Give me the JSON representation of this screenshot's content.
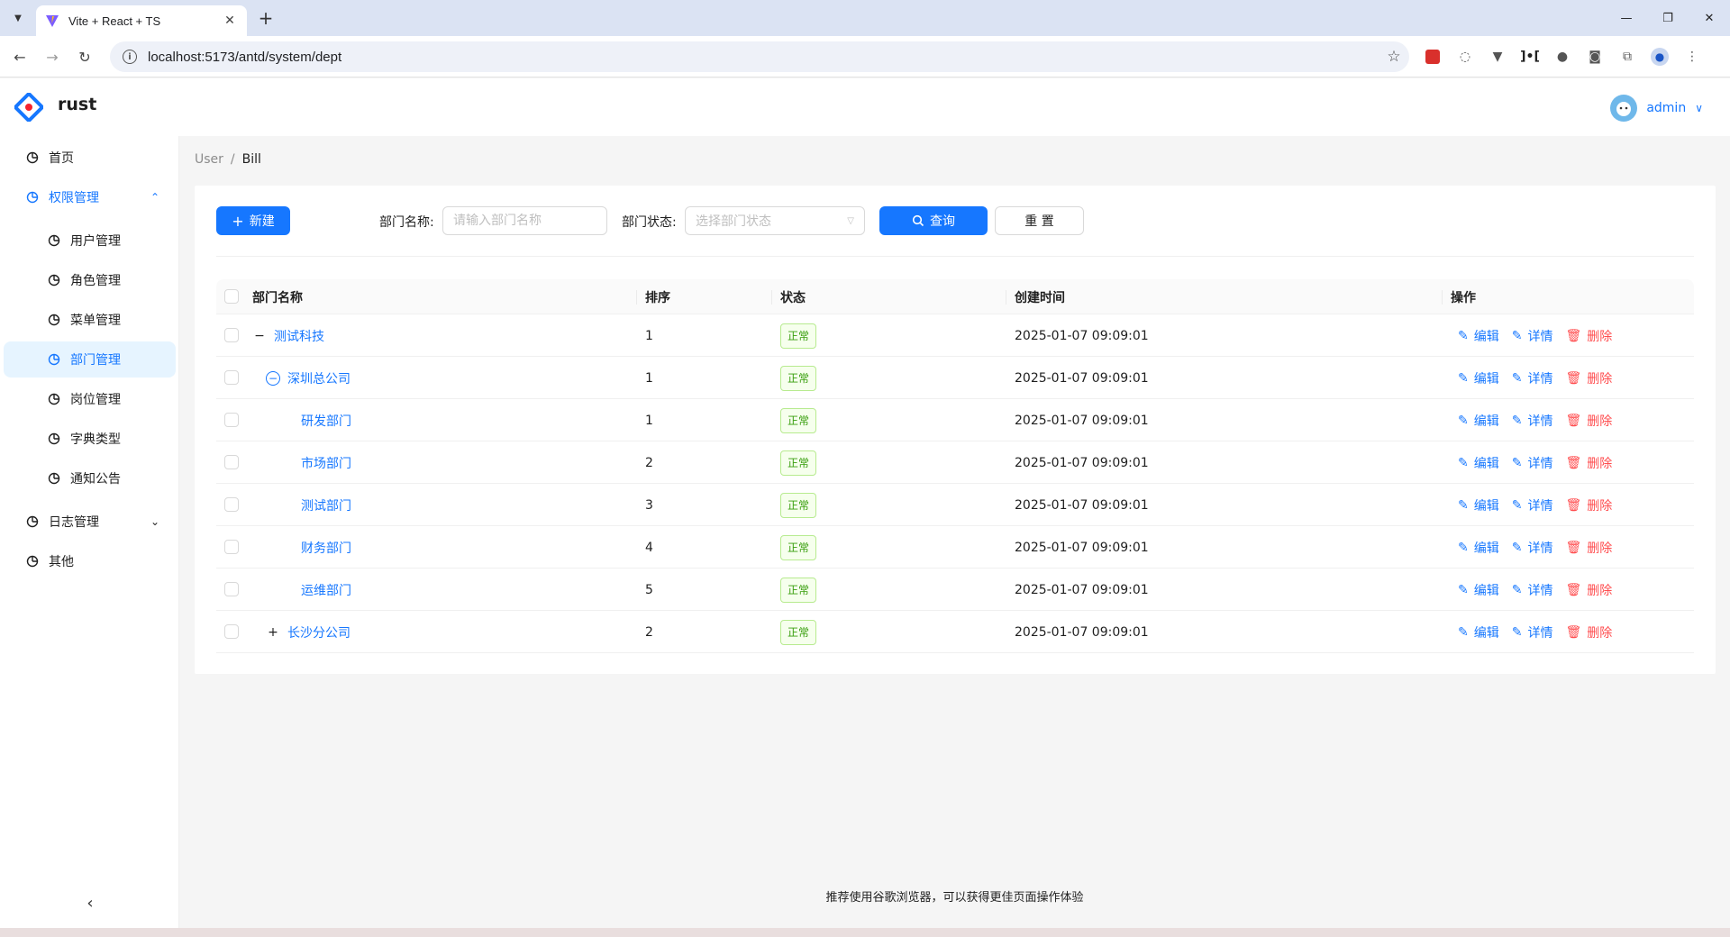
{
  "browser": {
    "tab_title": "Vite + React + TS",
    "url": "localhost:5173/antd/system/dept"
  },
  "app": {
    "brand": "rust",
    "user_name": "admin"
  },
  "sidebar": {
    "items": [
      {
        "label": "首页"
      },
      {
        "label": "权限管理"
      },
      {
        "label": "用户管理"
      },
      {
        "label": "角色管理"
      },
      {
        "label": "菜单管理"
      },
      {
        "label": "部门管理"
      },
      {
        "label": "岗位管理"
      },
      {
        "label": "字典类型"
      },
      {
        "label": "通知公告"
      },
      {
        "label": "日志管理"
      },
      {
        "label": "其他"
      }
    ]
  },
  "breadcrumb": {
    "parent": "User",
    "separator": "/",
    "current": "Bill"
  },
  "toolbar": {
    "new_label": "新建",
    "name_label": "部门名称:",
    "name_placeholder": "请输入部门名称",
    "status_label": "部门状态:",
    "status_placeholder": "选择部门状态",
    "search_label": "查询",
    "reset_label": "重 置"
  },
  "table": {
    "columns": [
      "部门名称",
      "排序",
      "状态",
      "创建时间",
      "操作"
    ],
    "actions": {
      "edit": "编辑",
      "detail": "详情",
      "delete": "删除"
    },
    "rows": [
      {
        "name": "测试科技",
        "sort": "1",
        "status": "正常",
        "created": "2025-01-07 09:09:01"
      },
      {
        "name": "深圳总公司",
        "sort": "1",
        "status": "正常",
        "created": "2025-01-07 09:09:01"
      },
      {
        "name": "研发部门",
        "sort": "1",
        "status": "正常",
        "created": "2025-01-07 09:09:01"
      },
      {
        "name": "市场部门",
        "sort": "2",
        "status": "正常",
        "created": "2025-01-07 09:09:01"
      },
      {
        "name": "测试部门",
        "sort": "3",
        "status": "正常",
        "created": "2025-01-07 09:09:01"
      },
      {
        "name": "财务部门",
        "sort": "4",
        "status": "正常",
        "created": "2025-01-07 09:09:01"
      },
      {
        "name": "运维部门",
        "sort": "5",
        "status": "正常",
        "created": "2025-01-07 09:09:01"
      },
      {
        "name": "长沙分公司",
        "sort": "2",
        "status": "正常",
        "created": "2025-01-07 09:09:01"
      }
    ]
  },
  "footer": {
    "text": "推荐使用谷歌浏览器，可以获得更佳页面操作体验"
  },
  "colors": {
    "primary": "#1677ff",
    "danger": "#ff4d4f",
    "success": "#389e0d"
  }
}
